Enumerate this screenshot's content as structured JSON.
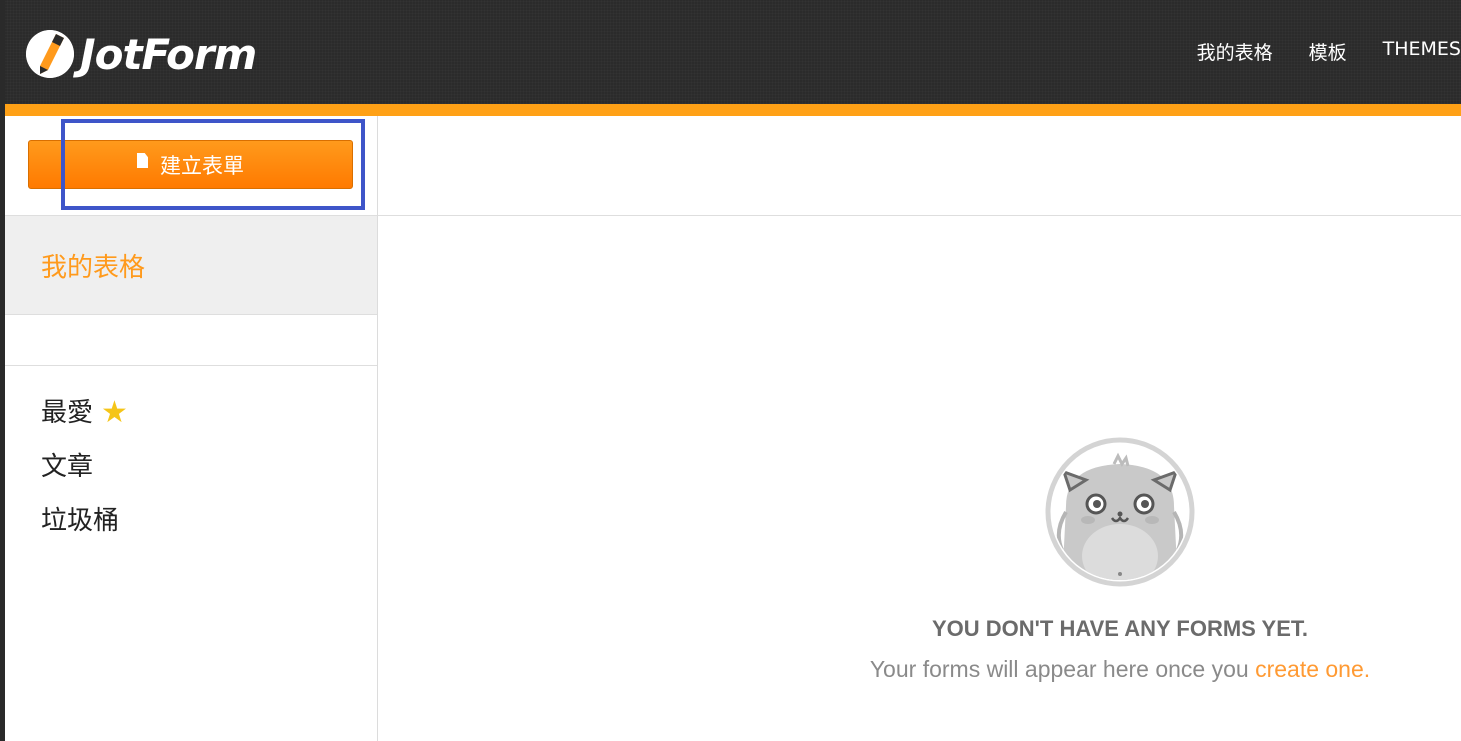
{
  "app": {
    "logo_text": "JotForm"
  },
  "topnav": {
    "items": [
      {
        "label": "我的表格"
      },
      {
        "label": "模板"
      },
      {
        "label": "THEMES"
      }
    ]
  },
  "sidebar": {
    "create_button_label": "建立表單",
    "my_forms_label": "我的表格",
    "folders": [
      {
        "label": "最愛",
        "icon": "star-icon"
      },
      {
        "label": "文章"
      },
      {
        "label": "垃圾桶"
      }
    ]
  },
  "empty_state": {
    "title": "YOU DON'T HAVE ANY FORMS YET.",
    "subtitle_prefix": "Your forms will appear here once you ",
    "subtitle_link": "create one."
  },
  "colors": {
    "accent_orange": "#ffa116",
    "highlight_blue": "#3e55c9",
    "topbar_dark": "#2b2b2b"
  }
}
